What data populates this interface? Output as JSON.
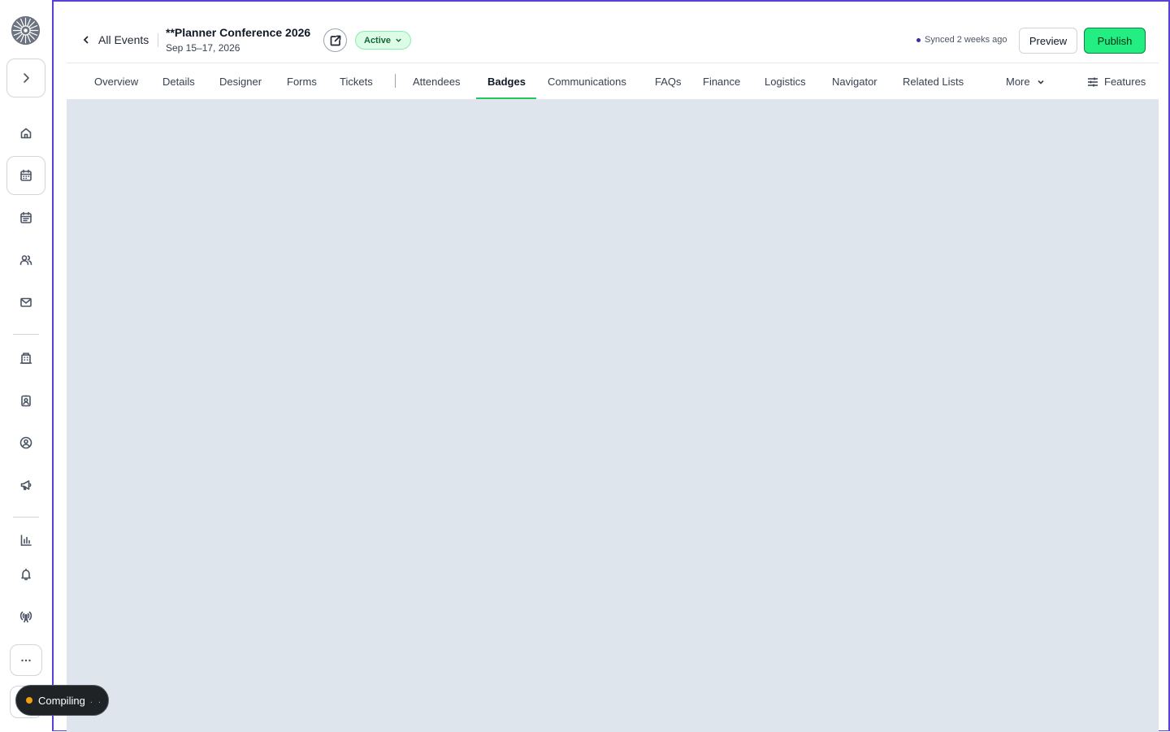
{
  "header": {
    "back_label": "All Events",
    "event_title": "**Planner Conference 2026",
    "event_dates": "Sep 15–17, 2026",
    "status_label": "Active",
    "sync_text": "Synced 2 weeks ago",
    "preview_label": "Preview",
    "publish_label": "Publish",
    "accent_color": "#22ee82"
  },
  "tabs": [
    {
      "label": "Overview"
    },
    {
      "label": "Details"
    },
    {
      "label": "Designer"
    },
    {
      "label": "Forms"
    },
    {
      "label": "Tickets"
    },
    {
      "label": "Attendees"
    },
    {
      "label": "Badges"
    },
    {
      "label": "Communications"
    },
    {
      "label": "FAQs"
    },
    {
      "label": "Finance"
    },
    {
      "label": "Logistics"
    },
    {
      "label": "Navigator"
    },
    {
      "label": "Related Lists"
    },
    {
      "label": "More"
    }
  ],
  "active_tab": "Badges",
  "features_label": "Features",
  "sidebar": {
    "icons": [
      "chevron-right-icon",
      "home-icon",
      "calendar-icon",
      "calendar-list-icon",
      "people-icon",
      "mail-icon",
      "building-icon",
      "badge-icon",
      "user-circle-icon",
      "megaphone-icon",
      "bar-chart-icon",
      "bell-icon",
      "broadcast-icon",
      "more-icon"
    ]
  },
  "compile_status": {
    "label": "Compiling",
    "ellipsis": ". ."
  }
}
